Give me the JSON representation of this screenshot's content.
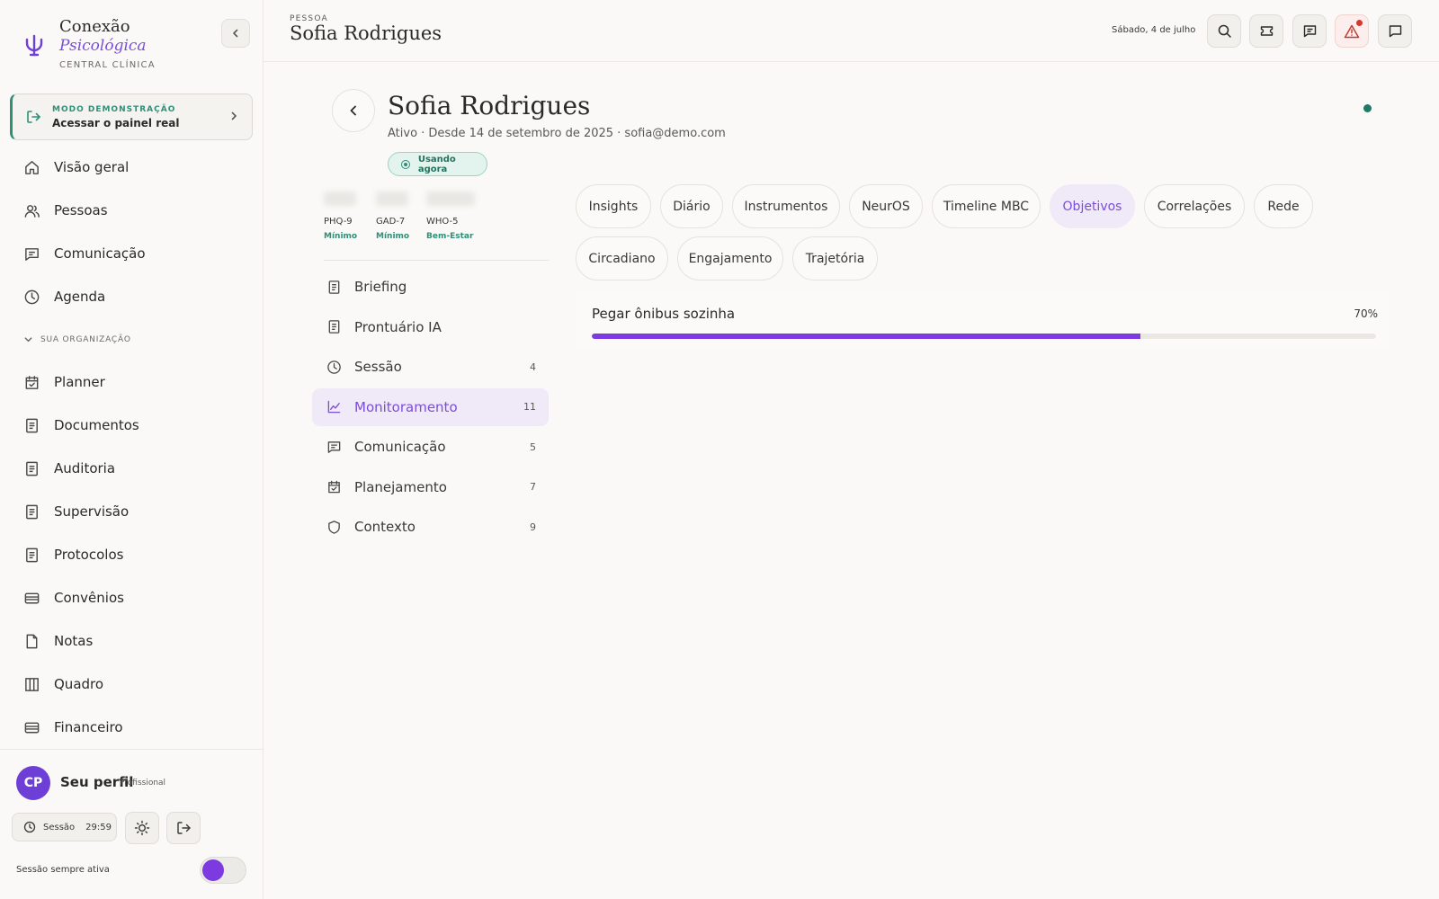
{
  "brand": {
    "title_line1": "Conexão",
    "title_line2": "Psicológica",
    "subtitle": "CENTRAL CLÍNICA"
  },
  "demo": {
    "label": "MODO DEMONSTRAÇÃO",
    "action": "Acessar o painel real"
  },
  "sidebar": {
    "items": [
      {
        "label": "Visão geral",
        "icon": "home-icon"
      },
      {
        "label": "Pessoas",
        "icon": "users-icon"
      },
      {
        "label": "Comunicação",
        "icon": "message-icon"
      },
      {
        "label": "Agenda",
        "icon": "clock-icon"
      }
    ],
    "org_header": "SUA ORGANIZAÇÃO",
    "org_items": [
      {
        "label": "Planner",
        "icon": "calendar-check-icon"
      },
      {
        "label": "Documentos",
        "icon": "document-icon"
      },
      {
        "label": "Auditoria",
        "icon": "document-icon"
      },
      {
        "label": "Supervisão",
        "icon": "document-icon"
      },
      {
        "label": "Protocolos",
        "icon": "document-icon"
      },
      {
        "label": "Convênios",
        "icon": "card-icon"
      },
      {
        "label": "Notas",
        "icon": "file-icon"
      },
      {
        "label": "Quadro",
        "icon": "columns-icon"
      },
      {
        "label": "Financeiro",
        "icon": "card-icon"
      }
    ]
  },
  "profile": {
    "initials": "CP",
    "name": "Seu perfil",
    "role": "Profissional",
    "session_label": "Sessão",
    "session_timer": "29:59",
    "always_active_label": "Sessão sempre ativa",
    "always_active_on": true
  },
  "topbar": {
    "kicker": "PESSOA",
    "title": "Sofia Rodrigues",
    "date": "Sábado, 4 de julho"
  },
  "person": {
    "name": "Sofia Rodrigues",
    "meta": "Ativo · Desde 14 de setembro de 2025 · sofia@demo.com",
    "status_pill": "Usando agora"
  },
  "scores": [
    {
      "name": "PHQ-9",
      "level": "Mínimo"
    },
    {
      "name": "GAD-7",
      "level": "Mínimo"
    },
    {
      "name": "WHO-5",
      "level": "Bem-Estar"
    }
  ],
  "sections": [
    {
      "label": "Briefing",
      "count": "",
      "icon": "document-icon"
    },
    {
      "label": "Prontuário IA",
      "count": "",
      "icon": "document-icon"
    },
    {
      "label": "Sessão",
      "count": "4",
      "icon": "clock-icon"
    },
    {
      "label": "Monitoramento",
      "count": "11",
      "icon": "chart-icon",
      "active": true
    },
    {
      "label": "Comunicação",
      "count": "5",
      "icon": "message-icon"
    },
    {
      "label": "Planejamento",
      "count": "7",
      "icon": "calendar-check-icon"
    },
    {
      "label": "Contexto",
      "count": "9",
      "icon": "shield-icon"
    }
  ],
  "tabs": [
    {
      "label": "Insights"
    },
    {
      "label": "Diário"
    },
    {
      "label": "Instrumentos"
    },
    {
      "label": "NeurOS"
    },
    {
      "label": "Timeline MBC"
    },
    {
      "label": "Objetivos",
      "active": true
    },
    {
      "label": "Correlações"
    },
    {
      "label": "Rede"
    },
    {
      "label": "Circadiano"
    },
    {
      "label": "Engajamento"
    },
    {
      "label": "Trajetória"
    }
  ],
  "goal": {
    "title": "Pegar ônibus sozinha",
    "progress_label": "70%",
    "progress": 0.7
  },
  "colors": {
    "accent": "#7c3ae0",
    "accent_soft": "#efe9f8",
    "teal": "#2f8f78",
    "alert": "#d33a2f"
  }
}
